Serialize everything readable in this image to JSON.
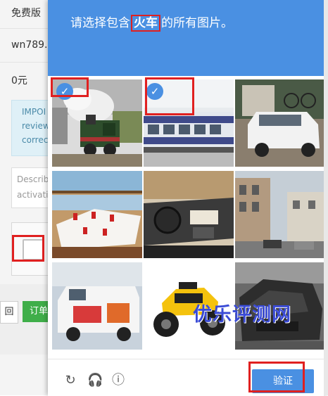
{
  "background_page": {
    "plan_label": "免费版",
    "order_id": "wn789.1",
    "price": "0元",
    "info_lines": [
      "IMPOI",
      "review",
      "correc"
    ],
    "textarea_placeholder_lines": [
      "Describ",
      "activatio"
    ],
    "back_button_label": "回",
    "order_button_label": "订单"
  },
  "captcha": {
    "prompt_before": "请选择包含",
    "prompt_keyword": "火车",
    "prompt_after": "的所有图片。",
    "tiles": [
      {
        "subject": "steam locomotive",
        "selected": true
      },
      {
        "subject": "passenger train car",
        "selected": true
      },
      {
        "subject": "white van with bicycles",
        "selected": false
      },
      {
        "subject": "restaurant dining room",
        "selected": false
      },
      {
        "subject": "car interior dashboard",
        "selected": false
      },
      {
        "subject": "street with buildings",
        "selected": false
      },
      {
        "subject": "white ambulance van",
        "selected": false
      },
      {
        "subject": "yellow ATV",
        "selected": false
      },
      {
        "subject": "crashed car",
        "selected": false
      }
    ],
    "check_glyph": "✓",
    "watermark": "优乐评测网",
    "footer": {
      "refresh_icon": "↻",
      "audio_icon": "🎧",
      "info_icon": "ⓘ",
      "verify_label": "验证"
    }
  },
  "colors": {
    "accent": "#4a90e2",
    "highlight": "#e02020",
    "order_button": "#3fae49"
  }
}
